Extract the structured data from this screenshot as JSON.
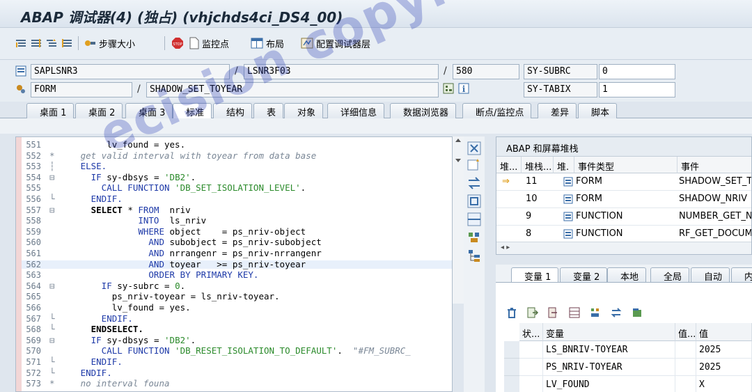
{
  "window": {
    "title": "ABAP 调试器(4) (独占) (vhjchds4ci_DS4_00)"
  },
  "toolbar": {
    "step_size": "步骤大小",
    "watchpoint": "监控点",
    "layout": "布局",
    "configure": "配置调试器层"
  },
  "fields": {
    "program": "SAPLSNR3",
    "include": "LSNR3F03",
    "line": "580",
    "event_type": "FORM",
    "event_name": "SHADOW_SET_TOYEAR",
    "sys1_name": "SY-SUBRC",
    "sys1_value": "0",
    "sys2_name": "SY-TABIX",
    "sys2_value": "1"
  },
  "tabs": [
    "桌面 1",
    "桌面 2",
    "桌面 3",
    "标准",
    "结构",
    "表",
    "对象",
    "详细信息",
    "数据浏览器",
    "断点/监控点",
    "差异",
    "脚本"
  ],
  "code": [
    {
      "n": "551",
      "g": "",
      "parts": [
        [
          "plain",
          "        lv_found = yes."
        ]
      ]
    },
    {
      "n": "552",
      "g": "*",
      "parts": [
        [
          "cmt",
          "   get valid interval with toyear from data base"
        ]
      ]
    },
    {
      "n": "553",
      "g": "┆",
      "parts": [
        [
          "kw",
          "   ELSE."
        ]
      ]
    },
    {
      "n": "554",
      "g": "⊟",
      "parts": [
        [
          "kw",
          "     IF "
        ],
        [
          "plain",
          "sy-dbsys = "
        ],
        [
          "str",
          "'DB2'"
        ],
        [
          "plain",
          "."
        ]
      ]
    },
    {
      "n": "555",
      "g": "",
      "parts": [
        [
          "kw",
          "       CALL FUNCTION "
        ],
        [
          "str",
          "'DB_SET_ISOLATION_LEVEL'"
        ],
        [
          "plain",
          "."
        ]
      ]
    },
    {
      "n": "556",
      "g": "└",
      "parts": [
        [
          "kw",
          "     ENDIF."
        ]
      ]
    },
    {
      "n": "557",
      "g": "⊟",
      "parts": [
        [
          "kwb",
          "     SELECT "
        ],
        [
          "plain",
          "* "
        ],
        [
          "kw",
          "FROM "
        ],
        [
          "plain",
          " nriv"
        ]
      ]
    },
    {
      "n": "558",
      "g": "",
      "parts": [
        [
          "kw",
          "              INTO "
        ],
        [
          "plain",
          " ls_nriv"
        ]
      ]
    },
    {
      "n": "559",
      "g": "",
      "parts": [
        [
          "kw",
          "              WHERE "
        ],
        [
          "plain",
          "object    = ps_nriv-object"
        ]
      ]
    },
    {
      "n": "560",
      "g": "",
      "parts": [
        [
          "kw",
          "                AND "
        ],
        [
          "plain",
          "subobject = ps_nriv-subobject"
        ]
      ]
    },
    {
      "n": "561",
      "g": "",
      "parts": [
        [
          "kw",
          "                AND "
        ],
        [
          "plain",
          "nrrangenr = ps_nriv-nrrangenr"
        ]
      ]
    },
    {
      "n": "562",
      "g": "",
      "parts": [
        [
          "kw",
          "                AND "
        ],
        [
          "plain",
          "toyear   >= ps_nriv-toyear"
        ]
      ]
    },
    {
      "n": "563",
      "g": "",
      "parts": [
        [
          "kw",
          "                ORDER BY PRIMARY KEY."
        ]
      ]
    },
    {
      "n": "564",
      "g": "⊟",
      "parts": [
        [
          "kw",
          "       IF "
        ],
        [
          "plain",
          "sy-subrc = "
        ],
        [
          "str",
          "0"
        ],
        [
          "plain",
          "."
        ]
      ]
    },
    {
      "n": "565",
      "g": "",
      "parts": [
        [
          "plain",
          "         ps_nriv-toyear = ls_nriv-toyear."
        ]
      ]
    },
    {
      "n": "566",
      "g": "",
      "parts": [
        [
          "plain",
          "         lv_found = yes."
        ]
      ]
    },
    {
      "n": "567",
      "g": "└",
      "parts": [
        [
          "kw",
          "       ENDIF."
        ]
      ]
    },
    {
      "n": "568",
      "g": "└",
      "parts": [
        [
          "kwb",
          "     ENDSELECT."
        ]
      ]
    },
    {
      "n": "569",
      "g": "⊟",
      "parts": [
        [
          "kw",
          "     IF "
        ],
        [
          "plain",
          "sy-dbsys = "
        ],
        [
          "str",
          "'DB2'"
        ],
        [
          "plain",
          "."
        ]
      ]
    },
    {
      "n": "570",
      "g": "",
      "parts": [
        [
          "kw",
          "       CALL FUNCTION "
        ],
        [
          "str",
          "'DB_RESET_ISOLATION_TO_DEFAULT'"
        ],
        [
          "plain",
          ".  "
        ],
        [
          "cmt",
          "\"#FM_SUBRC_"
        ]
      ]
    },
    {
      "n": "571",
      "g": "└",
      "parts": [
        [
          "kw",
          "     ENDIF."
        ]
      ]
    },
    {
      "n": "572",
      "g": "└",
      "parts": [
        [
          "kw",
          "   ENDIF."
        ]
      ]
    },
    {
      "n": "573",
      "g": "*",
      "parts": [
        [
          "cmt",
          "   no interval founa"
        ]
      ]
    }
  ],
  "stack": {
    "title": "ABAP 和屏幕堆栈",
    "columns": [
      "堆...",
      "堆栈...",
      "堆.",
      "事件类型",
      "事件"
    ],
    "rows": [
      {
        "level": "11",
        "type": "FORM",
        "event": "SHADOW_SET_TOYEAR",
        "current": true
      },
      {
        "level": "10",
        "type": "FORM",
        "event": "SHADOW_NRIV",
        "current": false
      },
      {
        "level": "9",
        "type": "FUNCTION",
        "event": "NUMBER_GET_NEXT",
        "current": false
      },
      {
        "level": "8",
        "type": "FUNCTION",
        "event": "RF_GET_DOCUMENT",
        "current": false
      }
    ]
  },
  "var_tabs": [
    "变量 1",
    "变量 2",
    "本地",
    "全局",
    "自动",
    "内"
  ],
  "vars": {
    "columns": [
      "状...",
      "变量",
      "值...",
      "值"
    ],
    "rows": [
      {
        "name": "LS_BNRIV-TOYEAR",
        "value": "2025"
      },
      {
        "name": "PS_NRIV-TOYEAR",
        "value": "2025"
      },
      {
        "name": "LV_FOUND",
        "value": "X"
      }
    ]
  },
  "watermark": "ecision copyright",
  "colors": {
    "accent": "#1e3aa8",
    "string": "#2a8a2a",
    "comment": "#7a8796",
    "stop": "#d03030"
  }
}
